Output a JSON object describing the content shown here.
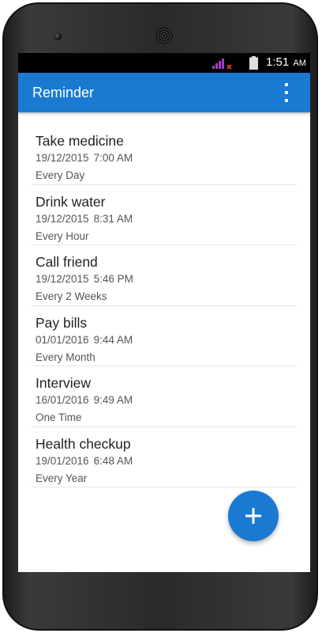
{
  "status_bar": {
    "time": "1:51",
    "ampm": "AM",
    "signal_icon": "signal-bars-no-data-icon",
    "battery_icon": "battery-icon"
  },
  "app_bar": {
    "title": "Reminder",
    "menu_icon": "overflow-menu-icon",
    "color": "#1a7ad2"
  },
  "reminders": [
    {
      "title": "Take medicine",
      "date": "19/12/2015",
      "time": "7:00 AM",
      "repeat": "Every Day"
    },
    {
      "title": "Drink water",
      "date": "19/12/2015",
      "time": "8:31 AM",
      "repeat": "Every Hour"
    },
    {
      "title": "Call friend",
      "date": "19/12/2015",
      "time": "5:46 PM",
      "repeat": "Every 2 Weeks"
    },
    {
      "title": "Pay bills",
      "date": "01/01/2016",
      "time": "9:44 AM",
      "repeat": "Every Month"
    },
    {
      "title": "Interview",
      "date": "16/01/2016",
      "time": "9:49 AM",
      "repeat": "One Time"
    },
    {
      "title": "Health checkup",
      "date": "19/01/2016",
      "time": "6:48 AM",
      "repeat": "Every Year"
    }
  ],
  "fab": {
    "icon": "plus-icon",
    "color": "#1a7ad2"
  }
}
